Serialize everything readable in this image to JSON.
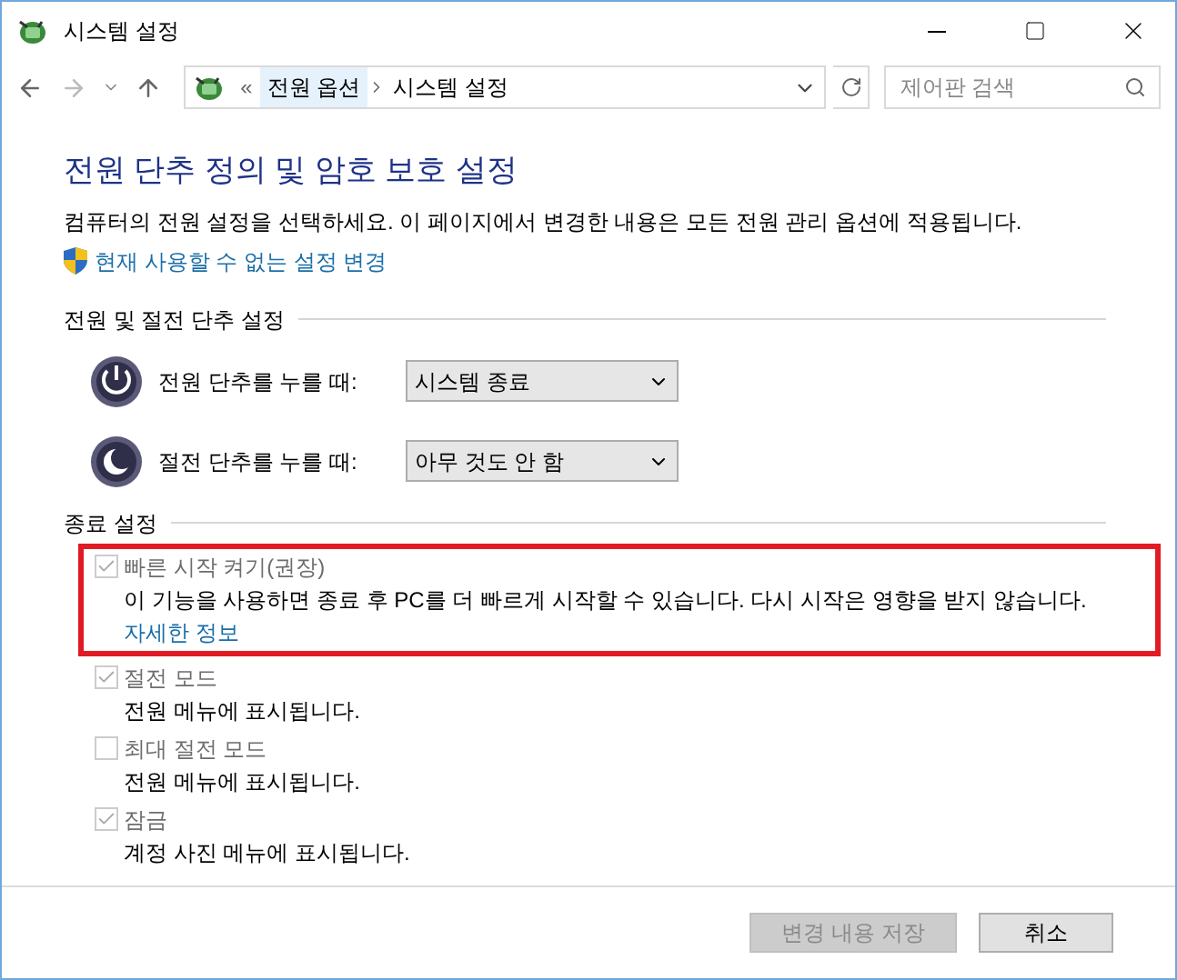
{
  "window": {
    "title": "시스템 설정"
  },
  "address_bar": {
    "overflow": "«",
    "crumbs": [
      {
        "label": "전원 옵션",
        "selected": true
      },
      {
        "label": "시스템 설정",
        "selected": false
      }
    ]
  },
  "search": {
    "placeholder": "제어판 검색"
  },
  "heading": "전원 단추 정의 및 암호 보호 설정",
  "description": "컴퓨터의 전원 설정을 선택하세요. 이 페이지에서 변경한 내용은 모든 전원 관리 옵션에 적용됩니다.",
  "admin_link": "현재 사용할 수 없는 설정 변경",
  "power_section": {
    "title": "전원 및 절전 단추 설정",
    "rows": [
      {
        "kind": "power",
        "label": "전원 단추를 누를 때:",
        "value": "시스템 종료"
      },
      {
        "kind": "sleep",
        "label": "절전 단추를 누를 때:",
        "value": "아무 것도 안 함"
      }
    ]
  },
  "shutdown_section": {
    "title": "종료 설정",
    "items": [
      {
        "label": "빠른 시작 켜기(권장)",
        "checked": true,
        "disabled": true,
        "highlighted": true,
        "description": "이 기능을 사용하면 종료 후 PC를 더 빠르게 시작할 수 있습니다. 다시 시작은 영향을 받지 않습니다.",
        "link": "자세한 정보"
      },
      {
        "label": "절전 모드",
        "checked": true,
        "disabled": true,
        "highlighted": false,
        "description": "전원 메뉴에 표시됩니다."
      },
      {
        "label": "최대 절전 모드",
        "checked": false,
        "disabled": true,
        "highlighted": false,
        "description": "전원 메뉴에 표시됩니다."
      },
      {
        "label": "잠금",
        "checked": true,
        "disabled": true,
        "highlighted": false,
        "description": "계정 사진 메뉴에 표시됩니다."
      }
    ]
  },
  "buttons": [
    {
      "label": "변경 내용 저장",
      "disabled": true
    },
    {
      "label": "취소",
      "disabled": false
    }
  ]
}
